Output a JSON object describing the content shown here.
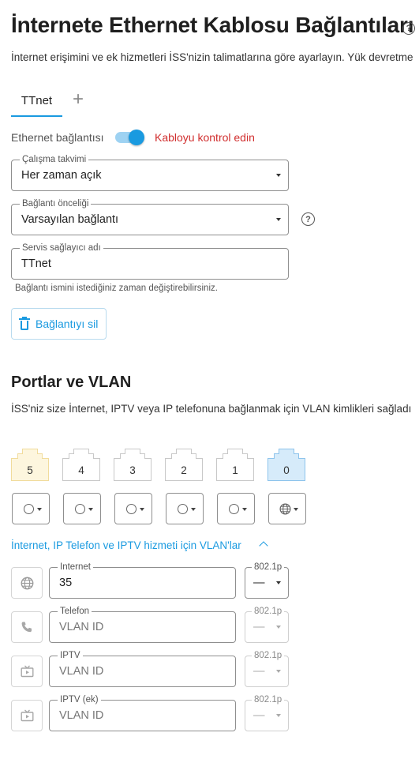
{
  "page": {
    "title": "İnternete Ethernet Kablosu Bağlantıları",
    "subtitle": "İnternet erişimini ve ek hizmetleri İSS'nizin talimatlarına göre ayarlayın. Yük devretme"
  },
  "tabs": [
    {
      "label": "TTnet"
    }
  ],
  "tab_add": "+",
  "ethernet": {
    "label": "Ethernet bağlantısı",
    "enabled": true,
    "warning": "Kabloyu kontrol edin"
  },
  "schedule": {
    "label": "Çalışma takvimi",
    "value": "Her zaman açık"
  },
  "priority": {
    "label": "Bağlantı önceliği",
    "value": "Varsayılan bağlantı"
  },
  "provider": {
    "label": "Servis sağlayıcı adı",
    "value": "TTnet",
    "hint": "Bağlantı ismini istediğiniz zaman değiştirebilirsiniz."
  },
  "delete_button": "Bağlantıyı sil",
  "ports_section": {
    "title": "Portlar ve VLAN",
    "description": "İSS'niz size İnternet, IPTV veya IP telefonuna bağlanmak için VLAN kimlikleri sağladı"
  },
  "ports": [
    {
      "number": "5",
      "state": "yellow",
      "mode": "circle-icon"
    },
    {
      "number": "4",
      "state": "normal",
      "mode": "circle-icon"
    },
    {
      "number": "3",
      "state": "normal",
      "mode": "circle-icon"
    },
    {
      "number": "2",
      "state": "normal",
      "mode": "circle-icon"
    },
    {
      "number": "1",
      "state": "normal",
      "mode": "circle-icon"
    },
    {
      "number": "0",
      "state": "blue",
      "mode": "globe-icon"
    }
  ],
  "vlan_toggle": "İnternet, IP Telefon ve IPTV hizmeti için VLAN'lar",
  "vlans": [
    {
      "icon": "globe-icon",
      "label": "Internet",
      "value": "35",
      "placeholder": "VLAN ID",
      "priority_label": "802.1p",
      "priority_value": "—",
      "active": true
    },
    {
      "icon": "phone-icon",
      "label": "Telefon",
      "value": "",
      "placeholder": "VLAN ID",
      "priority_label": "802.1p",
      "priority_value": "—",
      "active": false
    },
    {
      "icon": "tv-icon",
      "label": "IPTV",
      "value": "",
      "placeholder": "VLAN ID",
      "priority_label": "802.1p",
      "priority_value": "—",
      "active": false
    },
    {
      "icon": "tv-icon",
      "label": "IPTV (ek)",
      "value": "",
      "placeholder": "VLAN ID",
      "priority_label": "802.1p",
      "priority_value": "—",
      "active": false
    }
  ],
  "colors": {
    "accent": "#1a9ae0",
    "warning": "#d12f2f",
    "port_yellow_bg": "#fdf6de",
    "port_yellow_border": "#f1dc9c",
    "port_blue_bg": "#d6ebfa",
    "port_blue_border": "#8ec4ec"
  }
}
